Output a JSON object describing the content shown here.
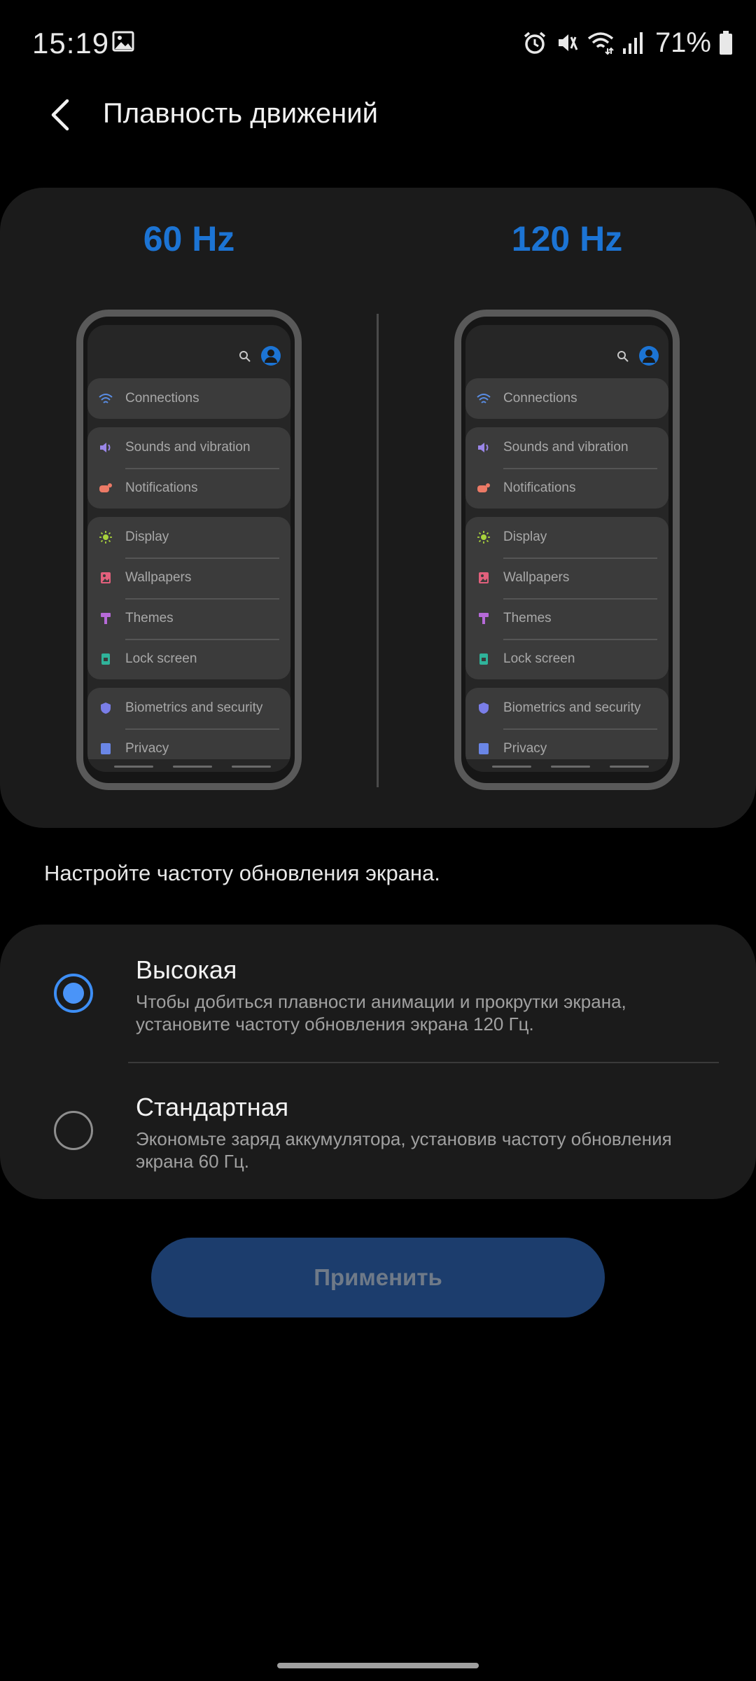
{
  "status_bar": {
    "time": "15:19",
    "battery": "71%",
    "icons": [
      "gallery-icon",
      "alarm-icon",
      "mute-icon",
      "wifi-icon",
      "signal-icon",
      "battery-icon"
    ]
  },
  "header": {
    "title": "Плавность движений",
    "back_icon": "chevron-left-icon"
  },
  "preview": {
    "left_label": "60 Hz",
    "right_label": "120 Hz",
    "settings_items": {
      "connections": "Connections",
      "sounds": "Sounds and vibration",
      "notifications": "Notifications",
      "display": "Display",
      "wallpapers": "Wallpapers",
      "themes": "Themes",
      "lock_screen": "Lock screen",
      "biometrics": "Biometrics and security",
      "privacy": "Privacy"
    }
  },
  "description": "Настройте частоту обновления экрана.",
  "options": [
    {
      "title": "Высокая",
      "desc": "Чтобы добиться плавности анимации и прокрутки экрана, установите частоту обновления экрана 120 Гц.",
      "selected": true
    },
    {
      "title": "Стандартная",
      "desc": "Экономьте заряд аккумулятора, установив частоту обновления экрана 60 Гц.",
      "selected": false
    }
  ],
  "apply_label": "Применить",
  "colors": {
    "accent": "#1c74d4",
    "radio_on": "#4a94f8",
    "card_bg": "#1b1b1b",
    "button_bg": "#1c3d6d"
  }
}
